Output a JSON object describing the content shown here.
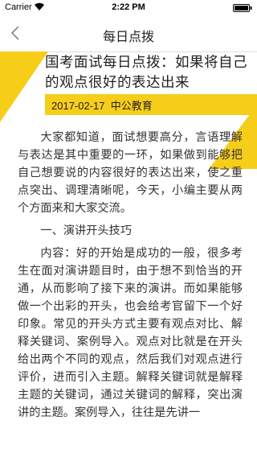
{
  "status_bar": {
    "carrier": "Carrier",
    "time": "2:22 PM"
  },
  "nav": {
    "title": "每日点拨",
    "back_icon": "chevron-left-icon"
  },
  "article": {
    "title": "国考面试每日点拨：如果将自己的观点很好的表达出来",
    "date": "2017-02-17",
    "source": "中公教育",
    "paragraphs": [
      "大家都知道，面试想要高分，言语理解与表达是其中重要的一环，如果做到能够把自己想要说的内容很好的表达出来，使之重点突出、调理清晰呢，今天，小编主要从两个方面来和大家交流。",
      "一、演讲开头技巧",
      "内容：好的开始是成功的一般，很多考生在面对演讲题目时，由于想不到恰当的开通，从而影响了接下来的演讲。而如果能够做一个出彩的开头，也会给考官留下一个好印象。常见的开头方式主要有观点对比、解释关键词、案例导入。观点对比就是在开头给出两个不同的观点，然后我们对观点进行评价，进而引入主题。解释关键词就是解释主题的关键词，通过关键词的解释，突出演讲的主题。案例导入，往往是先讲一"
    ]
  },
  "colors": {
    "accent": "#f6ce1a",
    "text": "#333333"
  }
}
